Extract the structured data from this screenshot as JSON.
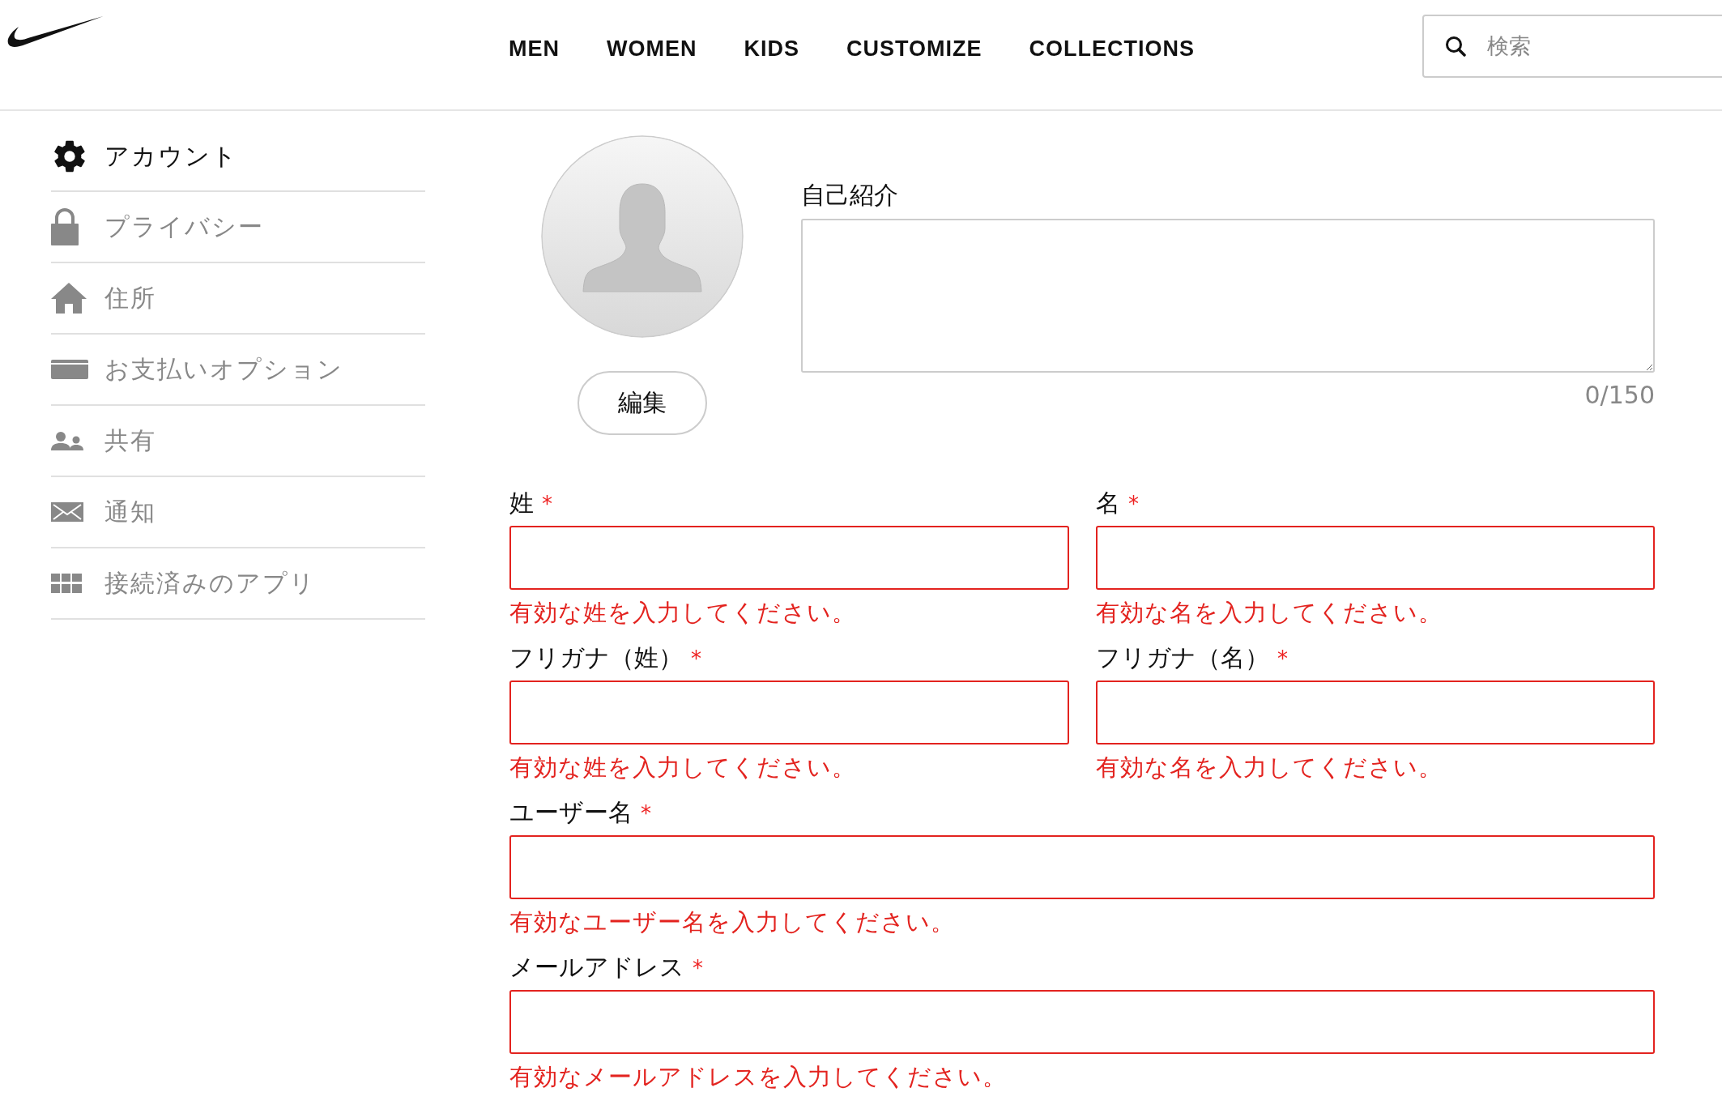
{
  "header": {
    "nav": [
      {
        "label": "MEN"
      },
      {
        "label": "WOMEN"
      },
      {
        "label": "KIDS"
      },
      {
        "label": "CUSTOMIZE"
      },
      {
        "label": "COLLECTIONS"
      }
    ],
    "search": {
      "placeholder": "検索"
    }
  },
  "sidebar": {
    "items": [
      {
        "label": "アカウント",
        "selected": true
      },
      {
        "label": "プライバシー",
        "selected": false
      },
      {
        "label": "住所",
        "selected": false
      },
      {
        "label": "お支払いオプション",
        "selected": false
      },
      {
        "label": "共有",
        "selected": false
      },
      {
        "label": "通知",
        "selected": false
      },
      {
        "label": "接続済みのアプリ",
        "selected": false
      }
    ]
  },
  "profile": {
    "edit_button": "編集",
    "bio": {
      "label": "自己紹介",
      "counter": "0/150"
    }
  },
  "form": {
    "fields": [
      {
        "kind": "half",
        "label": "姓",
        "mark": "*",
        "invalid": true,
        "error": "有効な姓を入力してください。"
      },
      {
        "kind": "half",
        "label": "名",
        "mark": "*",
        "invalid": true,
        "error": "有効な名を入力してください。"
      },
      {
        "kind": "half",
        "label": "フリガナ（姓）",
        "mark": "*",
        "invalid": true,
        "error": "有効な姓を入力してください。"
      },
      {
        "kind": "half",
        "label": "フリガナ（名）",
        "mark": "*",
        "invalid": true,
        "error": "有効な名を入力してください。"
      },
      {
        "kind": "full",
        "label": "ユーザー名",
        "mark": "*",
        "invalid": true,
        "error": "有効なユーザー名を入力してください。"
      },
      {
        "kind": "full",
        "label": "メールアドレス",
        "mark": "*",
        "invalid": true,
        "error": "有効なメールアドレスを入力してください。"
      }
    ]
  }
}
